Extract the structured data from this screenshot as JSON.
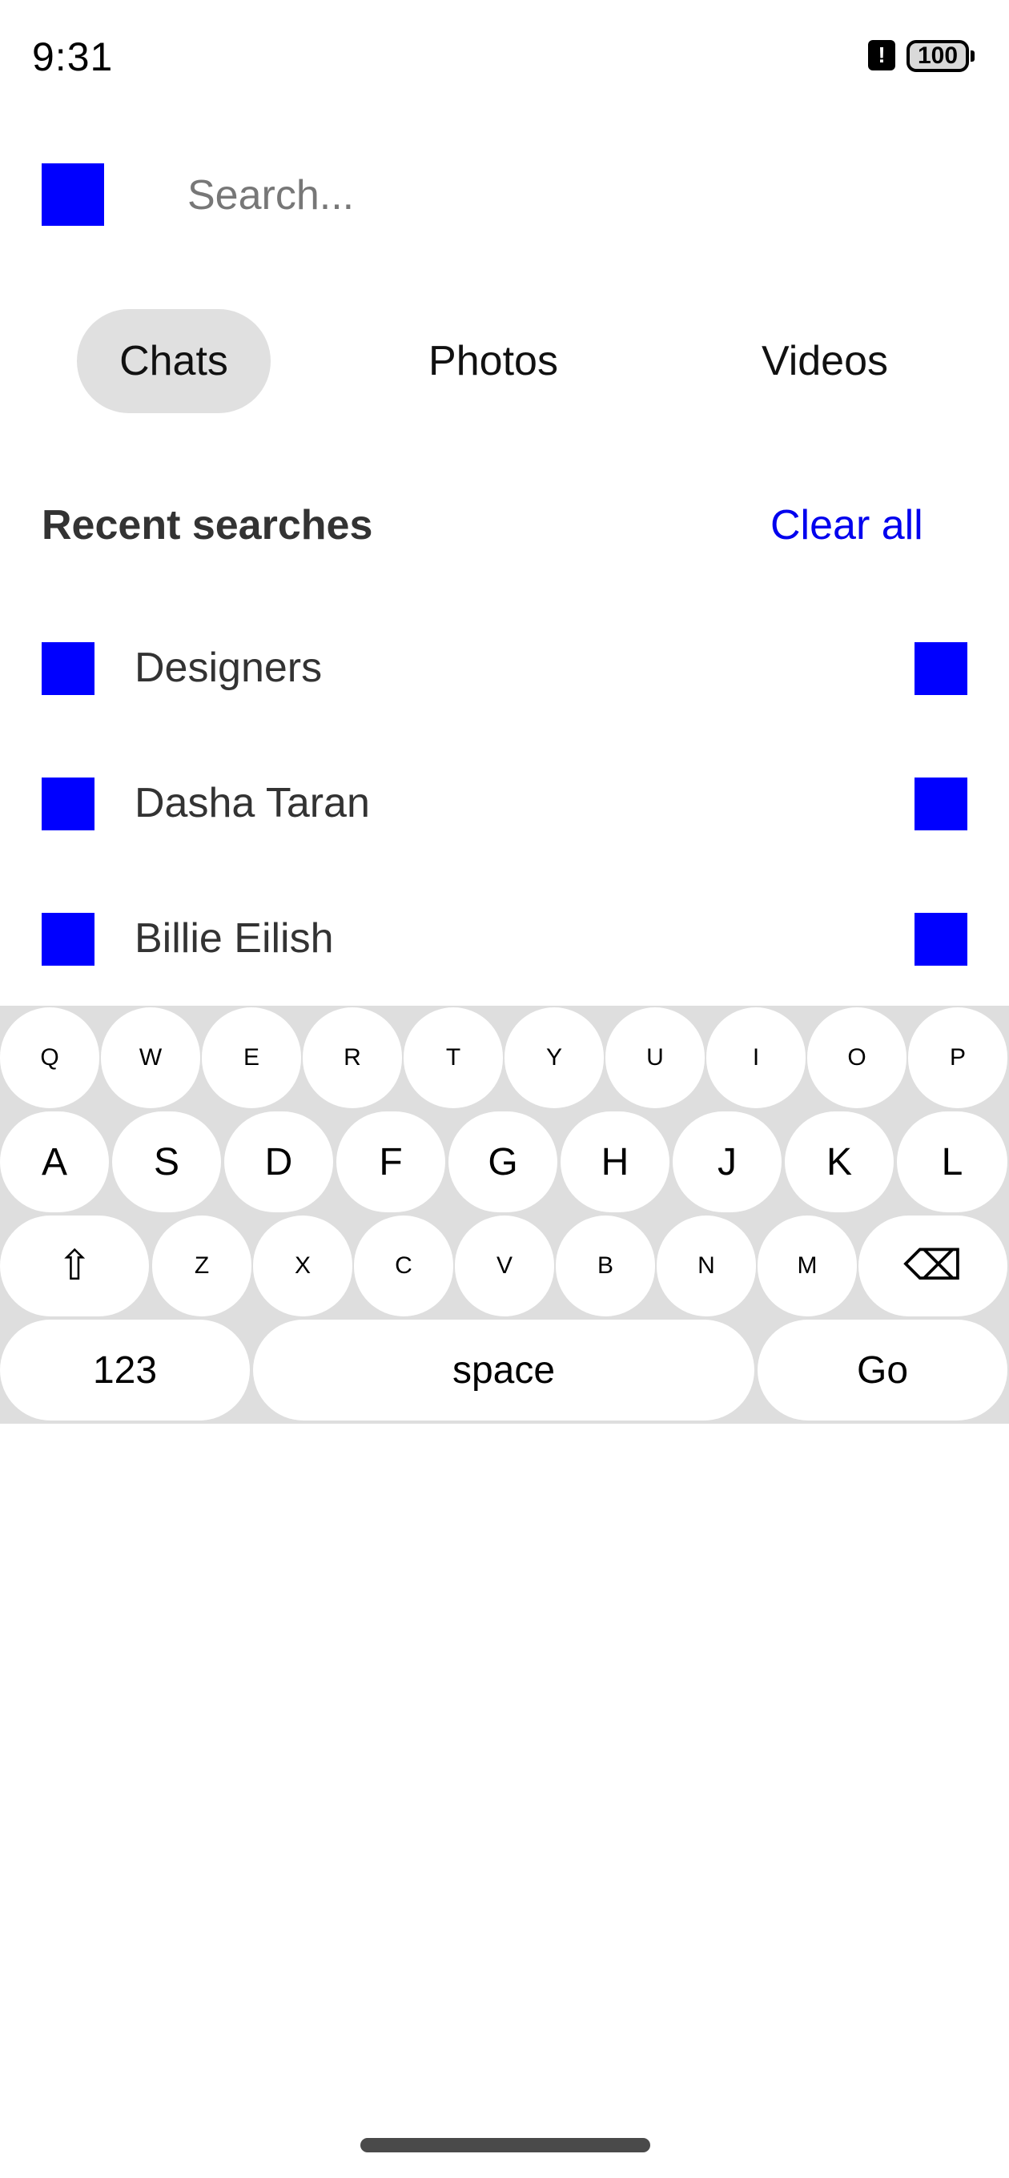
{
  "status_bar": {
    "time": "9:31",
    "alert_icon": "!",
    "battery": "100"
  },
  "search": {
    "icon": "search-icon",
    "placeholder": "Search...",
    "value": ""
  },
  "tabs": [
    {
      "label": "Chats",
      "active": true
    },
    {
      "label": "Photos",
      "active": false
    },
    {
      "label": "Videos",
      "active": false
    }
  ],
  "recent": {
    "title": "Recent searches",
    "clear_label": "Clear all",
    "items": [
      {
        "label": "Designers"
      },
      {
        "label": "Dasha Taran"
      },
      {
        "label": "Billie Eilish"
      }
    ]
  },
  "keyboard": {
    "row1": [
      "Q",
      "W",
      "E",
      "R",
      "T",
      "Y",
      "U",
      "I",
      "O",
      "P"
    ],
    "row2": [
      "A",
      "S",
      "D",
      "F",
      "G",
      "H",
      "J",
      "K",
      "L"
    ],
    "row3": [
      "Z",
      "X",
      "C",
      "V",
      "B",
      "N",
      "M"
    ],
    "shift_symbol": "⇧",
    "delete_symbol": "⌫",
    "numbers_label": "123",
    "space_label": "space",
    "go_label": "Go"
  },
  "colors": {
    "icon_placeholder": "#0000ff",
    "link": "#0000ee",
    "tab_active_bg": "#e0e0e0",
    "keyboard_bg": "#dedede"
  }
}
